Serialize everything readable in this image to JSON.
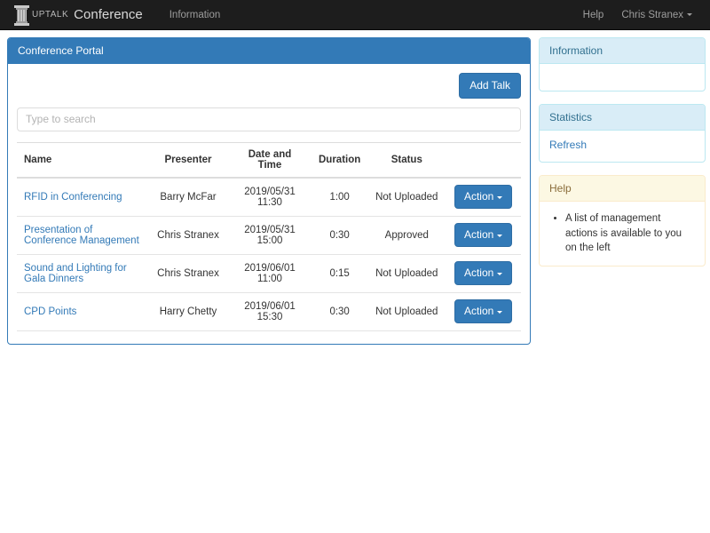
{
  "navbar": {
    "brand_prefix": "UPTALK",
    "brand_name": "Conference",
    "logo_icon": "column-pillar-icon",
    "links": [
      {
        "label": "Information",
        "name": "nav-link-information"
      }
    ],
    "right_links": [
      {
        "label": "Help",
        "name": "nav-link-help"
      }
    ],
    "user_menu": {
      "label": "Chris Stranex",
      "caret_icon": "chevron-down-icon"
    }
  },
  "main_panel": {
    "title": "Conference Portal",
    "add_talk_label": "Add Talk",
    "search": {
      "placeholder": "Type to search",
      "value": ""
    },
    "table": {
      "columns": [
        "Name",
        "Presenter",
        "Date and Time",
        "Duration",
        "Status",
        ""
      ],
      "action_label": "Action",
      "action_caret_icon": "chevron-down-icon",
      "rows": [
        {
          "name": "RFID in Conferencing",
          "presenter": "Barry McFar",
          "datetime": "2019/05/31 11:30",
          "duration": "1:00",
          "status": "Not Uploaded"
        },
        {
          "name": "Presentation of Conference Management",
          "presenter": "Chris Stranex",
          "datetime": "2019/05/31 15:00",
          "duration": "0:30",
          "status": "Approved"
        },
        {
          "name": "Sound and Lighting for Gala Dinners",
          "presenter": "Chris Stranex",
          "datetime": "2019/06/01 11:00",
          "duration": "0:15",
          "status": "Not Uploaded"
        },
        {
          "name": "CPD Points",
          "presenter": "Harry Chetty",
          "datetime": "2019/06/01 15:30",
          "duration": "0:30",
          "status": "Not Uploaded"
        }
      ]
    }
  },
  "sidebar": {
    "information_panel": {
      "title": "Information",
      "body": ""
    },
    "statistics_panel": {
      "title": "Statistics",
      "refresh_label": "Refresh"
    },
    "help_panel": {
      "title": "Help",
      "items": [
        "A list of management actions is available to you on the left"
      ]
    }
  },
  "colors": {
    "navbar_bg": "#1d1d1d",
    "primary": "#337ab7",
    "primary_border": "#2e6da4",
    "info_bg": "#d9edf7",
    "info_border": "#bce8f1",
    "info_text": "#31708f",
    "warning_bg": "#fcf8e3",
    "warning_border": "#faebcc",
    "warning_text": "#8a6d3b",
    "link": "#337ab7",
    "table_border": "#dddddd"
  }
}
